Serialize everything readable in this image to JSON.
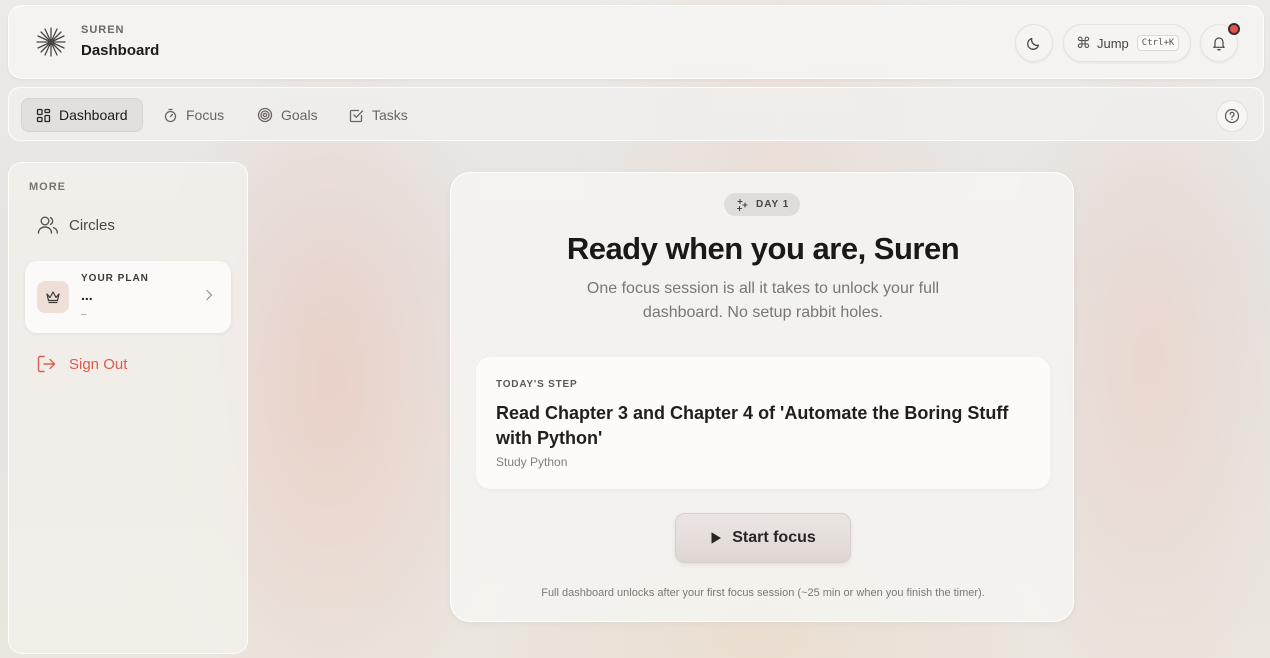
{
  "header": {
    "brand_small": "SUREN",
    "brand_title": "Dashboard",
    "jump_label": "Jump",
    "jump_shortcut": "Ctrl+K"
  },
  "nav": {
    "items": [
      {
        "label": "Dashboard",
        "icon": "grid-icon",
        "active": true
      },
      {
        "label": "Focus",
        "icon": "stopwatch-icon"
      },
      {
        "label": "Goals",
        "icon": "target-icon"
      },
      {
        "label": "Tasks",
        "icon": "checkbox-icon"
      }
    ]
  },
  "sidebar": {
    "heading": "MORE",
    "circles_label": "Circles",
    "plan": {
      "label": "YOUR PLAN",
      "name": "...",
      "sub": "–"
    },
    "signout_label": "Sign Out"
  },
  "main": {
    "day_badge": "DAY 1",
    "title": "Ready when you are, Suren",
    "subtitle": "One focus session is all it takes to unlock your full dashboard. No setup rabbit holes.",
    "step": {
      "label": "TODAY'S STEP",
      "title": "Read Chapter 3 and Chapter 4 of 'Automate the Boring Stuff with Python'",
      "goal": "Study Python"
    },
    "start_label": "Start focus",
    "footnote": "Full dashboard unlocks after your first focus session (~25 min or when you finish the timer)."
  },
  "colors": {
    "accent_red": "#df5a4f",
    "notification": "#e0524d"
  }
}
